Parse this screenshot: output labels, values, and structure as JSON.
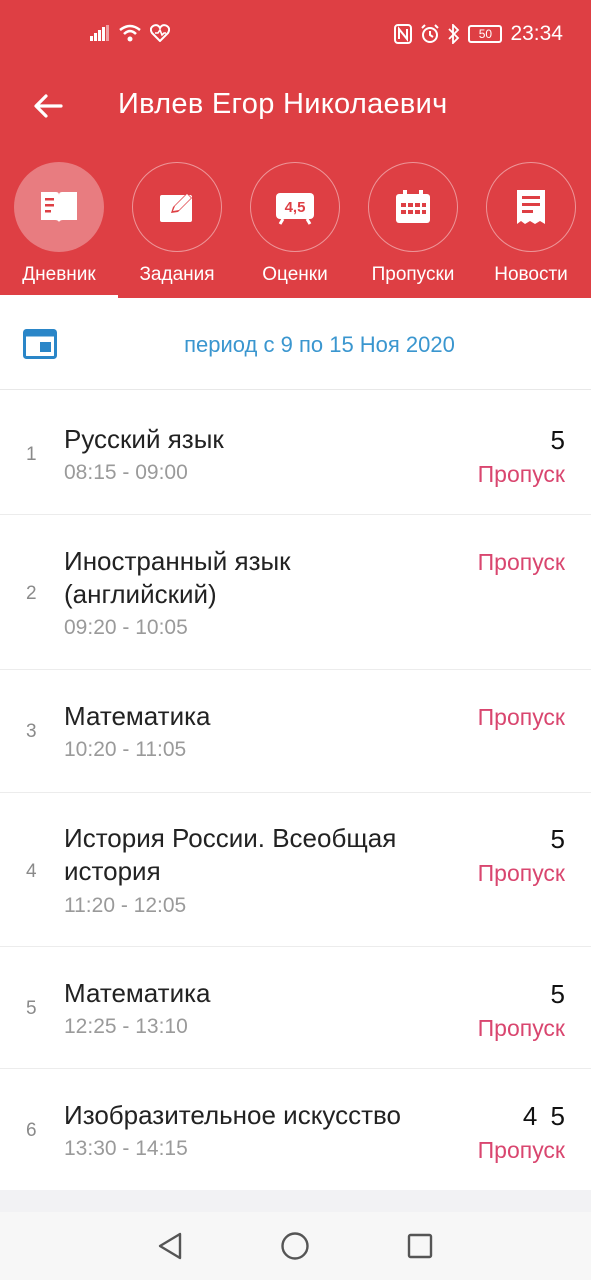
{
  "status_bar": {
    "time": "23:34",
    "battery": "50",
    "icons": [
      "signal-icon",
      "wifi-icon",
      "heart-icon",
      "nfc-icon",
      "alarm-icon",
      "bluetooth-icon",
      "battery-icon"
    ]
  },
  "header": {
    "title": "Ивлев Егор Николаевич",
    "back_icon": "arrow-left-icon",
    "accent_color": "#de3f44"
  },
  "tabs": [
    {
      "label": "Дневник",
      "icon": "book-icon",
      "active": true
    },
    {
      "label": "Задания",
      "icon": "edit-icon",
      "active": false
    },
    {
      "label": "Оценки",
      "icon": "grades-icon",
      "icon_text": "4,5",
      "active": false
    },
    {
      "label": "Пропуски",
      "icon": "calendar-icon",
      "active": false
    },
    {
      "label": "Новости",
      "icon": "news-icon",
      "active": false
    }
  ],
  "period": {
    "text": "период с 9 по 15 Ноя 2020",
    "icon": "calendar-week-icon",
    "color": "#3a96cf"
  },
  "lessons": [
    {
      "num": "1",
      "subject": "Русский язык",
      "time": "08:15 - 09:00",
      "grade": "5",
      "absence": "Пропуск"
    },
    {
      "num": "2",
      "subject": "Иностранный язык (английский)",
      "time": "09:20 - 10:05",
      "grade": "",
      "absence": "Пропуск"
    },
    {
      "num": "3",
      "subject": "Математика",
      "time": "10:20 - 11:05",
      "grade": "",
      "absence": "Пропуск"
    },
    {
      "num": "4",
      "subject": "История России. Всеобщая история",
      "time": "11:20 - 12:05",
      "grade": "5",
      "absence": "Пропуск"
    },
    {
      "num": "5",
      "subject": "Математика",
      "time": "12:25 - 13:10",
      "grade": "5",
      "absence": "Пропуск"
    },
    {
      "num": "6",
      "subject": "Изобразительное искусство",
      "time": "13:30 - 14:15",
      "grade": "4 5",
      "absence": "Пропуск"
    }
  ],
  "absence_color": "#d9466f",
  "nav": [
    "back-triangle-icon",
    "home-circle-icon",
    "recents-square-icon"
  ]
}
